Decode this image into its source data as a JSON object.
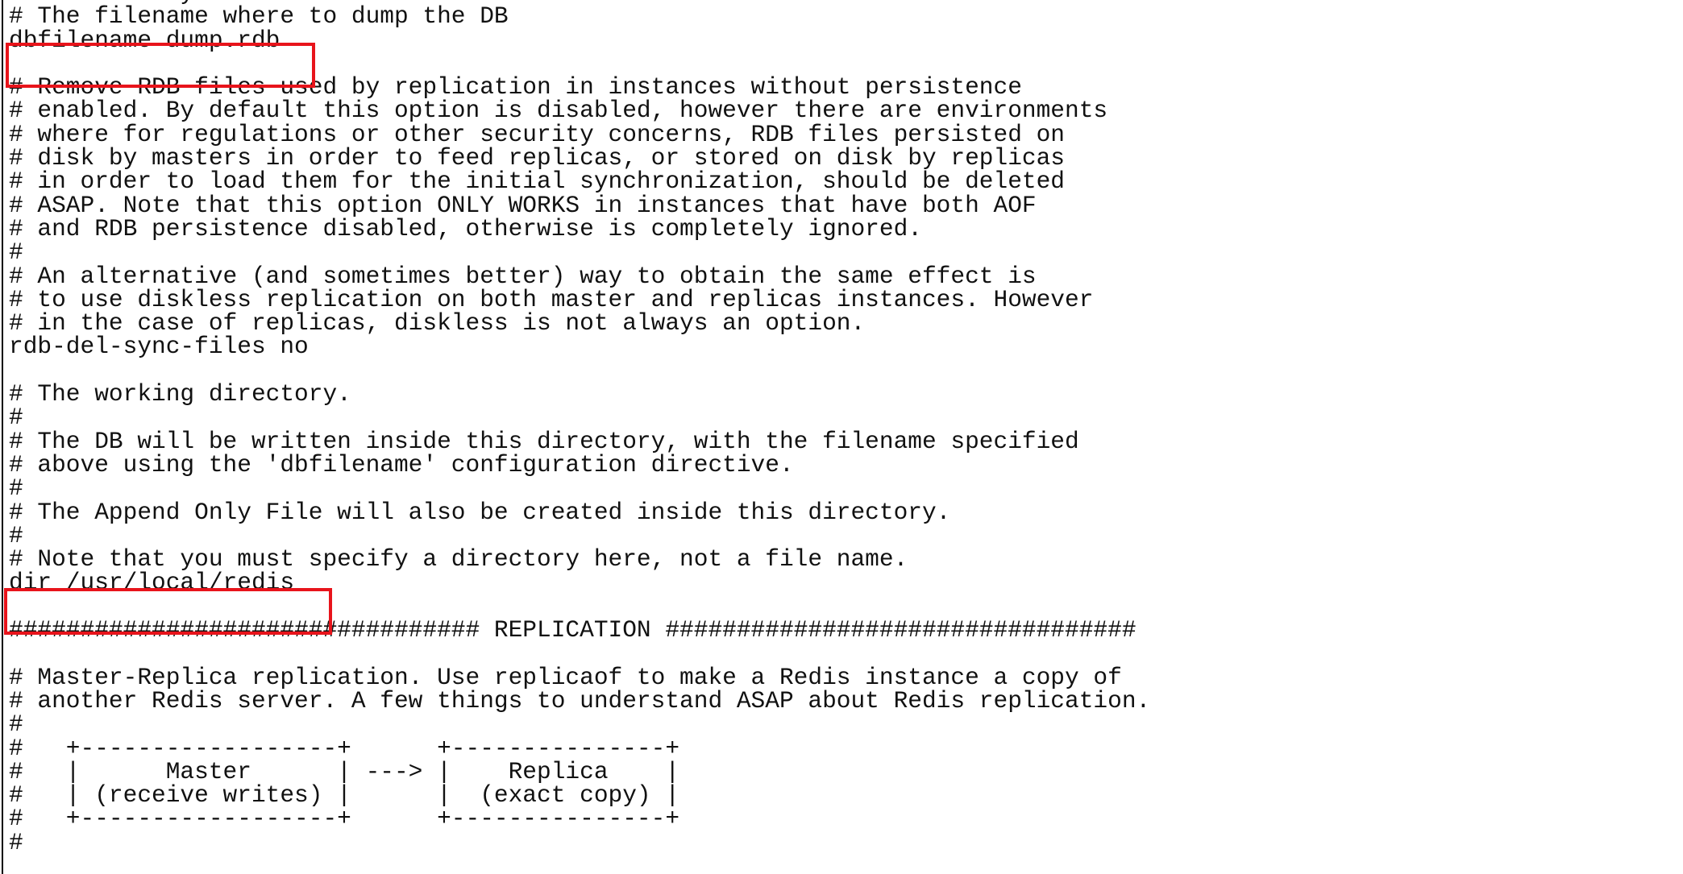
{
  "editor": {
    "lines": [
      "rdbchecksum yes",
      "# The filename where to dump the DB",
      "dbfilename dump.rdb",
      "",
      "# Remove RDB files used by replication in instances without persistence",
      "# enabled. By default this option is disabled, however there are environments",
      "# where for regulations or other security concerns, RDB files persisted on",
      "# disk by masters in order to feed replicas, or stored on disk by replicas",
      "# in order to load them for the initial synchronization, should be deleted",
      "# ASAP. Note that this option ONLY WORKS in instances that have both AOF",
      "# and RDB persistence disabled, otherwise is completely ignored.",
      "#",
      "# An alternative (and sometimes better) way to obtain the same effect is",
      "# to use diskless replication on both master and replicas instances. However",
      "# in the case of replicas, diskless is not always an option.",
      "rdb-del-sync-files no",
      "",
      "# The working directory.",
      "#",
      "# The DB will be written inside this directory, with the filename specified",
      "# above using the 'dbfilename' configuration directive.",
      "#",
      "# The Append Only File will also be created inside this directory.",
      "#",
      "# Note that you must specify a directory here, not a file name.",
      "dir /usr/local/redis",
      "",
      "################################# REPLICATION #################################",
      "",
      "# Master-Replica replication. Use replicaof to make a Redis instance a copy of",
      "# another Redis server. A few things to understand ASAP about Redis replication.",
      "#",
      "#   +------------------+      +---------------+",
      "#   |      Master      | ---> |    Replica    |",
      "#   | (receive writes) |      |  (exact copy) |",
      "#   +------------------+      +---------------+",
      "#"
    ]
  },
  "highlights": {
    "color": "#e8141b",
    "items": [
      "dbfilename dump.rdb",
      "dir /usr/local/redis"
    ]
  }
}
